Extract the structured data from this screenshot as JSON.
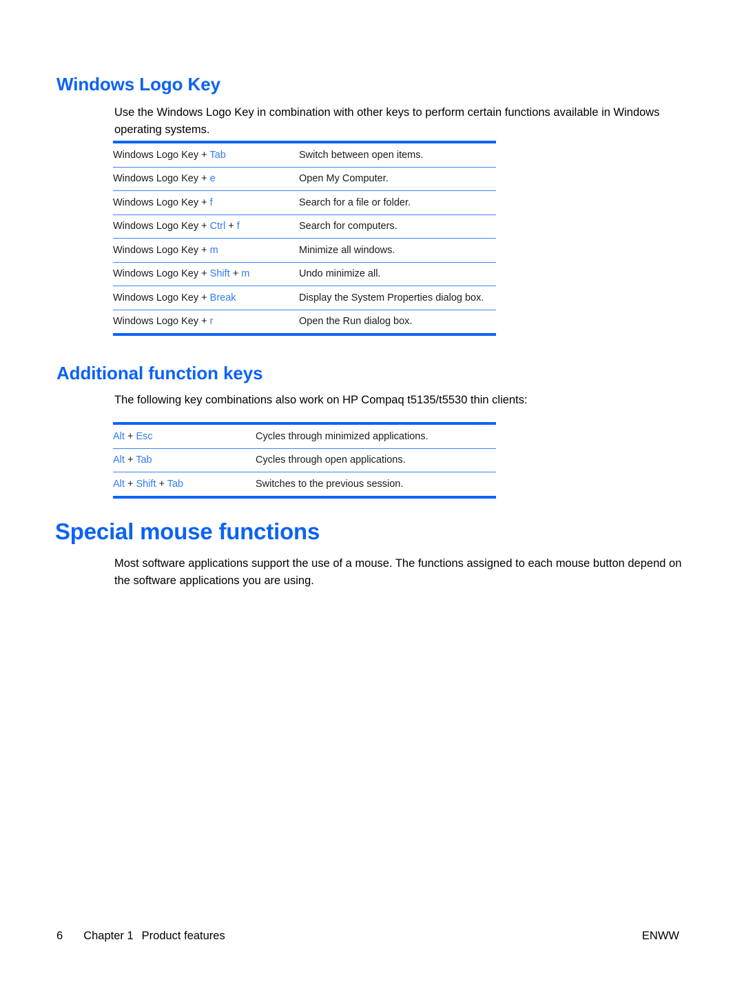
{
  "page": {
    "number": "6",
    "chapter": "Chapter 1",
    "chapter_title": "Product features",
    "language_code": "ENWW",
    "accent_color": "#0b62f5",
    "key_color": "#2f7bf6",
    "rule_color": "#0d63f5"
  },
  "sections": [
    {
      "heading": "Windows Logo Key",
      "intro": "Use the Windows Logo Key in combination with other keys to perform certain functions available in Windows operating systems.",
      "table": {
        "rows": [
          {
            "keys_prefix": "Windows Logo Key + ",
            "keys_accent": "Tab",
            "keys_suffix": "",
            "keys_accent2": "",
            "description": "Switch between open items."
          },
          {
            "keys_prefix": "Windows Logo Key + ",
            "keys_accent": "e",
            "keys_suffix": "",
            "keys_accent2": "",
            "description": "Open My Computer."
          },
          {
            "keys_prefix": "Windows Logo Key + ",
            "keys_accent": "f",
            "keys_suffix": "",
            "keys_accent2": "",
            "description": "Search for a file or folder."
          },
          {
            "keys_prefix": "Windows Logo Key + ",
            "keys_accent": "Ctrl",
            "keys_suffix": " + ",
            "keys_accent2": "f",
            "description": "Search for computers."
          },
          {
            "keys_prefix": "Windows Logo Key + ",
            "keys_accent": "m",
            "keys_suffix": "",
            "keys_accent2": "",
            "description": "Minimize all windows."
          },
          {
            "keys_prefix": "Windows Logo Key + ",
            "keys_accent": "Shift",
            "keys_suffix": " + ",
            "keys_accent2": "m",
            "description": "Undo minimize all."
          },
          {
            "keys_prefix": "Windows Logo Key + ",
            "keys_accent": "Break",
            "keys_suffix": "",
            "keys_accent2": "",
            "description": "Display the System Properties dialog box."
          },
          {
            "keys_prefix": "Windows Logo Key + ",
            "keys_accent": "r",
            "keys_suffix": "",
            "keys_accent2": "",
            "description": "Open the Run dialog box."
          }
        ]
      }
    },
    {
      "heading": "Additional function keys",
      "intro": "The following key combinations also work on HP Compaq t5135/t5530 thin clients:",
      "table": {
        "rows": [
          {
            "keys_accent": "Alt",
            "keys_sep1": " + ",
            "keys_accent2": "Esc",
            "keys_sep2": "",
            "keys_accent3": "",
            "description": "Cycles through minimized applications."
          },
          {
            "keys_accent": "Alt",
            "keys_sep1": " + ",
            "keys_accent2": "Tab",
            "keys_sep2": "",
            "keys_accent3": "",
            "description": "Cycles through open applications."
          },
          {
            "keys_accent": "Alt",
            "keys_sep1": " + ",
            "keys_accent2": "Shift",
            "keys_sep2": " + ",
            "keys_accent3": "Tab",
            "description": "Switches to the previous session."
          }
        ]
      }
    },
    {
      "heading": "Special mouse functions",
      "intro": "Most software applications support the use of a mouse. The functions assigned to each mouse button depend on the software applications you are using."
    }
  ]
}
